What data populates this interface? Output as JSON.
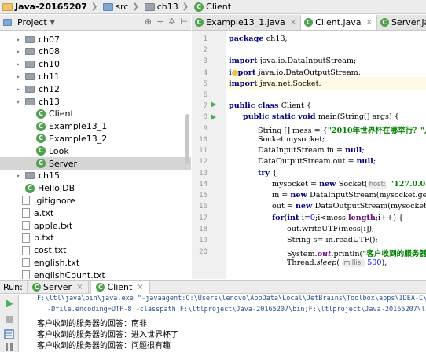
{
  "breadcrumb": {
    "project": "Java-20165207",
    "src": "src",
    "pkg": "ch13",
    "cls": "Client"
  },
  "project_panel": {
    "title": "Project",
    "tree": [
      {
        "label": "ch07",
        "type": "package",
        "depth": 2,
        "arrow": "▸"
      },
      {
        "label": "ch08",
        "type": "package",
        "depth": 2,
        "arrow": "▸"
      },
      {
        "label": "ch10",
        "type": "package",
        "depth": 2,
        "arrow": "▸"
      },
      {
        "label": "ch11",
        "type": "package",
        "depth": 2,
        "arrow": "▸"
      },
      {
        "label": "ch12",
        "type": "package",
        "depth": 2,
        "arrow": "▸"
      },
      {
        "label": "ch13",
        "type": "package",
        "depth": 2,
        "arrow": "▾"
      },
      {
        "label": "Client",
        "type": "class",
        "depth": 3,
        "arrow": ""
      },
      {
        "label": "Example13_1",
        "type": "class",
        "depth": 3,
        "arrow": ""
      },
      {
        "label": "Example13_2",
        "type": "class",
        "depth": 3,
        "arrow": ""
      },
      {
        "label": "Look",
        "type": "class",
        "depth": 3,
        "arrow": ""
      },
      {
        "label": "Server",
        "type": "class",
        "depth": 3,
        "arrow": "",
        "selected": true
      },
      {
        "label": "ch15",
        "type": "package",
        "depth": 2,
        "arrow": "▸"
      },
      {
        "label": "HelloJDB",
        "type": "class",
        "depth": 2,
        "arrow": ""
      },
      {
        "label": ".gitignore",
        "type": "file",
        "depth": 1,
        "arrow": ""
      },
      {
        "label": "a.txt",
        "type": "file",
        "depth": 1,
        "arrow": ""
      },
      {
        "label": "apple.txt",
        "type": "file",
        "depth": 1,
        "arrow": ""
      },
      {
        "label": "b.txt",
        "type": "file",
        "depth": 1,
        "arrow": ""
      },
      {
        "label": "cost.txt",
        "type": "file",
        "depth": 1,
        "arrow": ""
      },
      {
        "label": "english.txt",
        "type": "file",
        "depth": 1,
        "arrow": ""
      },
      {
        "label": "englishCount.txt",
        "type": "file",
        "depth": 1,
        "arrow": ""
      }
    ]
  },
  "editor_tabs": [
    {
      "label": "Example13_1.java",
      "active": false
    },
    {
      "label": "Client.java",
      "active": true
    },
    {
      "label": "Server.java",
      "active": false
    }
  ],
  "editor": {
    "line_numbers": [
      "1",
      "2",
      "3",
      "4",
      "5",
      "6",
      "7",
      "8",
      "9",
      "10",
      "11",
      "12",
      "13",
      "14",
      "15",
      "16",
      "17",
      "18",
      "19",
      "20"
    ],
    "lines": {
      "l1_kw": "package ",
      "l1_rest": "ch13;",
      "l3_kw": "import ",
      "l3_rest": "java.io.DataInputStream;",
      "l4_a": "i",
      "l4_b": "port ",
      "l4_rest": "java.io.DataOutputStream;",
      "l5_kw": "import ",
      "l5_rest": "java.net.Socket;",
      "l7_kw": "public class ",
      "l7_rest": "Client {",
      "l8_kw": "public static void ",
      "l8_rest": "main(String[] args) {",
      "l9_a": "String [] mess = {",
      "l9_str": "\"2010年世界杯在哪举行？\",\"巴",
      "l10": "Socket mysocket;",
      "l11_a": "DataInputStream in = ",
      "l11_kw": "null",
      "l11_b": ";",
      "l12_a": "DataOutputStream out = ",
      "l12_kw": "null",
      "l12_b": ";",
      "l13_kw": "try ",
      "l13_b": "{",
      "l14_a": "mysocket = ",
      "l14_kw": "new ",
      "l14_b": "Socket(",
      "l14_hint": "host:",
      "l14_str": " \"127.0.0.1\",",
      "l15_a": "in = ",
      "l15_kw": "new ",
      "l15_b": "DataInputStream(mysocket.getInputSt",
      "l16_a": "out = ",
      "l16_kw": "new ",
      "l16_b": "DataOutputStream(mysocket.getOutpu",
      "l17_kw": "for",
      "l17_a": "(",
      "l17_kw2": "int ",
      "l17_b": "i=",
      "l17_n": "0",
      "l17_c": ";i<mess.",
      "l17_f": "length",
      "l17_d": ";i++) {",
      "l18": "out.writeUTF(mess[i]);",
      "l19": "String s= in.readUTF();",
      "l20_a": "System.",
      "l20_f": "out",
      "l20_b": ".println(",
      "l20_str": "\"客户收到的服务器的",
      "l21_a": "Thread.",
      "l21_it": "sleep",
      "l21_b": "( ",
      "l21_hint": "millis:",
      "l21_n": " 500",
      "l21_c": ");"
    }
  },
  "run_panel": {
    "label": "Run:",
    "tabs": [
      {
        "label": "Server",
        "active": false
      },
      {
        "label": "Client",
        "active": true
      }
    ],
    "console": {
      "cmd1": "F:\\ltl\\java\\bin\\java.exe \"-javaagent:C:\\Users\\lenovo\\AppData\\Local\\JetBrains\\Toolbox\\apps\\IDEA-C\\ch-0\\181.4445.",
      "cmd2": "-Dfile.encoding=UTF-8 -classpath F:\\ltlproject\\Java-20165207\\bin;F:\\ltlproject\\Java-20165207\\lib\\mysql-conne",
      "out1": "客户收到的服务器的回答：南非",
      "out2": "客户收到的服务器的回答：进入世界杯了",
      "out3": "客户收到的服务器的回答：问题很有趣"
    }
  }
}
